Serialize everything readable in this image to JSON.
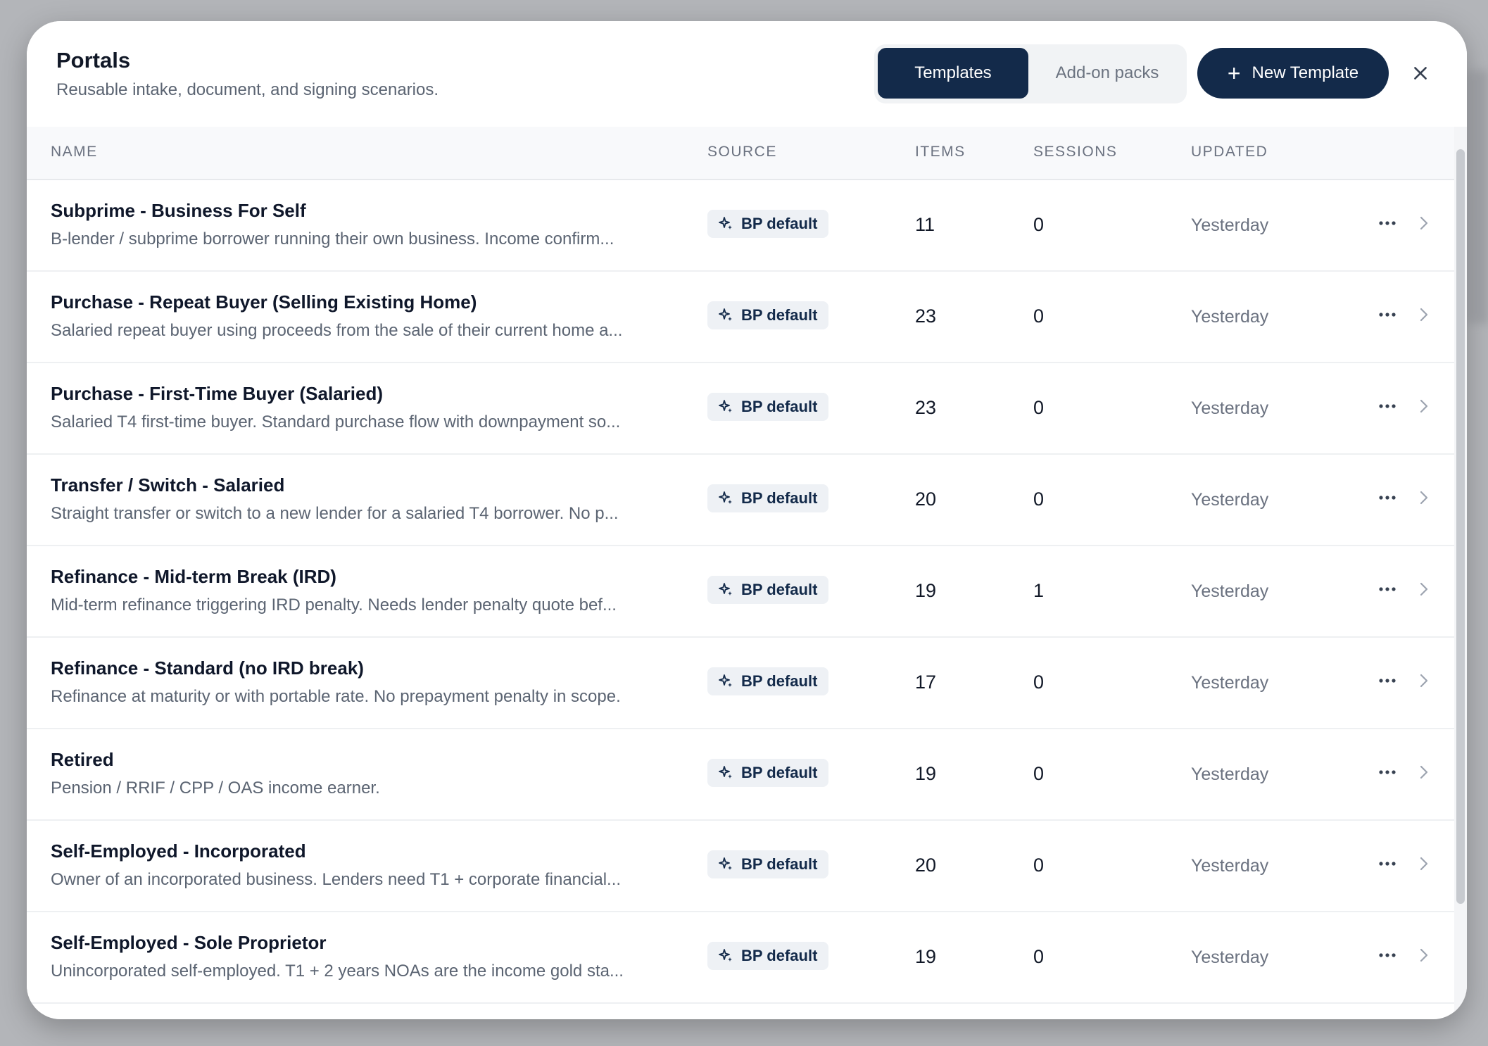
{
  "header": {
    "title": "Portals",
    "subtitle": "Reusable intake, document, and signing scenarios."
  },
  "tabs": [
    {
      "label": "Templates",
      "active": true
    },
    {
      "label": "Add-on packs",
      "active": false
    }
  ],
  "new_template_label": "New Template",
  "columns": {
    "name": "NAME",
    "source": "SOURCE",
    "items": "ITEMS",
    "sessions": "SESSIONS",
    "updated": "UPDATED"
  },
  "colors": {
    "primary": "#132a4a",
    "badge_bg": "#eef1f5"
  },
  "rows": [
    {
      "name": "Subprime - Business For Self",
      "description": "B-lender / subprime borrower running their own business. Income confirm...",
      "source": "BP default",
      "items": "11",
      "sessions": "0",
      "updated": "Yesterday"
    },
    {
      "name": "Purchase - Repeat Buyer (Selling Existing Home)",
      "description": "Salaried repeat buyer using proceeds from the sale of their current home a...",
      "source": "BP default",
      "items": "23",
      "sessions": "0",
      "updated": "Yesterday"
    },
    {
      "name": "Purchase - First-Time Buyer (Salaried)",
      "description": "Salaried T4 first-time buyer. Standard purchase flow with downpayment so...",
      "source": "BP default",
      "items": "23",
      "sessions": "0",
      "updated": "Yesterday"
    },
    {
      "name": "Transfer / Switch - Salaried",
      "description": "Straight transfer or switch to a new lender for a salaried T4 borrower. No p...",
      "source": "BP default",
      "items": "20",
      "sessions": "0",
      "updated": "Yesterday"
    },
    {
      "name": "Refinance - Mid-term Break (IRD)",
      "description": "Mid-term refinance triggering IRD penalty. Needs lender penalty quote bef...",
      "source": "BP default",
      "items": "19",
      "sessions": "1",
      "updated": "Yesterday"
    },
    {
      "name": "Refinance - Standard (no IRD break)",
      "description": "Refinance at maturity or with portable rate. No prepayment penalty in scope.",
      "source": "BP default",
      "items": "17",
      "sessions": "0",
      "updated": "Yesterday"
    },
    {
      "name": "Retired",
      "description": "Pension / RRIF / CPP / OAS income earner.",
      "source": "BP default",
      "items": "19",
      "sessions": "0",
      "updated": "Yesterday"
    },
    {
      "name": "Self-Employed - Incorporated",
      "description": "Owner of an incorporated business. Lenders need T1 + corporate financial...",
      "source": "BP default",
      "items": "20",
      "sessions": "0",
      "updated": "Yesterday"
    },
    {
      "name": "Self-Employed - Sole Proprietor",
      "description": "Unincorporated self-employed. T1 + 2 years NOAs are the income gold sta...",
      "source": "BP default",
      "items": "19",
      "sessions": "0",
      "updated": "Yesterday"
    }
  ]
}
